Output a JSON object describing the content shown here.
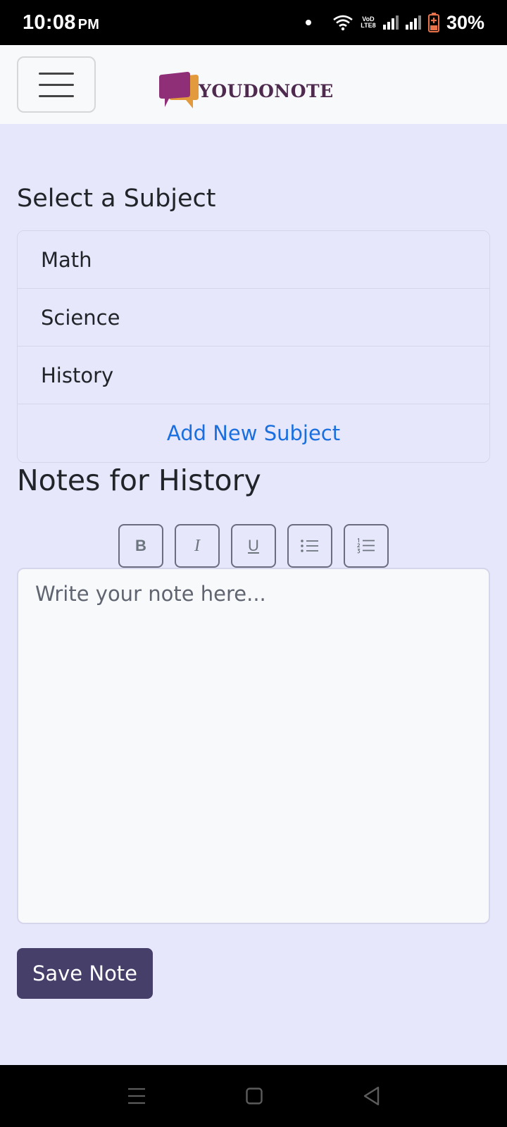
{
  "status_bar": {
    "time": "10:08",
    "ampm": "PM",
    "volte_line1": "VoD",
    "volte_line2": "LTE8",
    "battery": "30%"
  },
  "navbar": {
    "brand_name": "YOUDONOTE",
    "menu_icon": "hamburger-icon",
    "logo_colors": {
      "front": "#8e2f77",
      "back": "#e39a3c"
    }
  },
  "subjects": {
    "heading": "Select a Subject",
    "items": [
      "Math",
      "Science",
      "History"
    ],
    "add_label": "Add New Subject"
  },
  "notes": {
    "heading": "Notes for History",
    "toolbar": [
      {
        "label": "B",
        "icon": "bold-icon"
      },
      {
        "label": "I",
        "icon": "italic-icon"
      },
      {
        "label": "U",
        "icon": "underline-icon"
      },
      {
        "label": "",
        "icon": "bullet-list-icon"
      },
      {
        "label": "",
        "icon": "numbered-list-icon"
      }
    ],
    "placeholder": "Write your note here...",
    "value": "",
    "save_label": "Save Note"
  },
  "colors": {
    "background": "#e6e7fb",
    "accent_link": "#1a6fe0",
    "save_button": "#463f69"
  }
}
